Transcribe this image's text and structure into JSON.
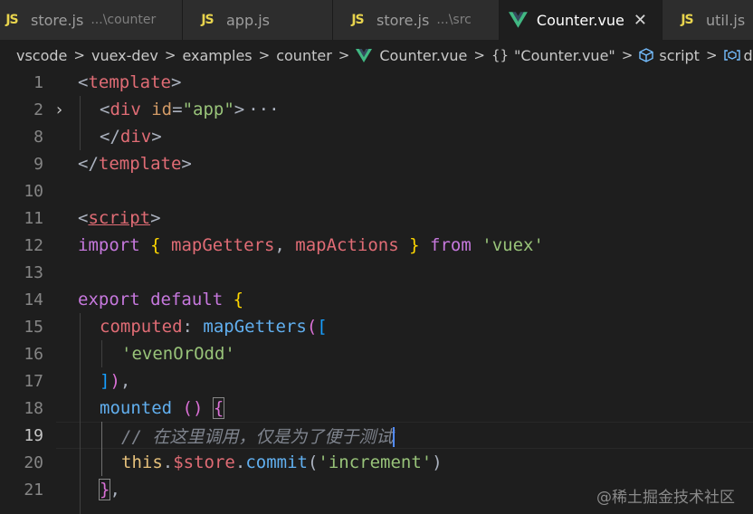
{
  "tabs": [
    {
      "icon": "JS",
      "label": "store.js",
      "hint": "...\\counter",
      "active": false
    },
    {
      "icon": "JS",
      "label": "app.js",
      "hint": "",
      "active": false
    },
    {
      "icon": "JS",
      "label": "store.js",
      "hint": "...\\src",
      "active": false
    },
    {
      "icon": "vue",
      "label": "Counter.vue",
      "hint": "",
      "active": true,
      "close": "✕"
    },
    {
      "icon": "JS",
      "label": "util.js",
      "hint": "",
      "active": false
    }
  ],
  "breadcrumb": {
    "items": [
      "vscode",
      "vuex-dev",
      "examples",
      "counter",
      "Counter.vue",
      "\"Counter.vue\"",
      "script",
      "def"
    ],
    "braces_glyph": "{}",
    "separator": ">"
  },
  "editor": {
    "current_line": "19",
    "line_numbers": [
      "1",
      "2",
      "8",
      "9",
      "10",
      "11",
      "12",
      "13",
      "14",
      "15",
      "16",
      "17",
      "18",
      "19",
      "20",
      "21"
    ],
    "folded_ellipsis": "···",
    "tokens": {
      "l1_lt": "<",
      "l1_tag": "template",
      "l1_gt": ">",
      "l2_lt": "<",
      "l2_tag": "div",
      "l2_attr": "id",
      "l2_eq": "=",
      "l2_str": "\"app\"",
      "l2_gt": ">",
      "l8_lt": "</",
      "l8_tag": "div",
      "l8_gt": ">",
      "l9_lt": "</",
      "l9_tag": "template",
      "l9_gt": ">",
      "l11_lt": "<",
      "l11_tag": "script",
      "l11_gt": ">",
      "l12_import": "import",
      "l12_ob": "{",
      "l12_a": "mapGetters",
      "l12_comma": ",",
      "l12_b": "mapActions",
      "l12_cb": "}",
      "l12_from": "from",
      "l12_str": "'vuex'",
      "l14_export": "export",
      "l14_default": "default",
      "l14_ob": "{",
      "l15_prop": "computed",
      "l15_colon": ":",
      "l15_fn": "mapGetters",
      "l15_p": "(",
      "l15_b": "[",
      "l16_str": "'evenOrOdd'",
      "l17_b": "]",
      "l17_p": ")",
      "l17_comma": ",",
      "l18_fn": "mounted",
      "l18_p": "()",
      "l18_ob": "{",
      "l19_comment": "// 在这里调用，仅是为了便于测试",
      "l20_this": "this",
      "l20_dot1": ".",
      "l20_store": "$store",
      "l20_dot2": ".",
      "l20_fn": "commit",
      "l20_po": "(",
      "l20_str": "'increment'",
      "l20_pc": ")",
      "l21_cb": "}",
      "l21_comma": ","
    }
  },
  "watermark": "@稀土掘金技术社区"
}
